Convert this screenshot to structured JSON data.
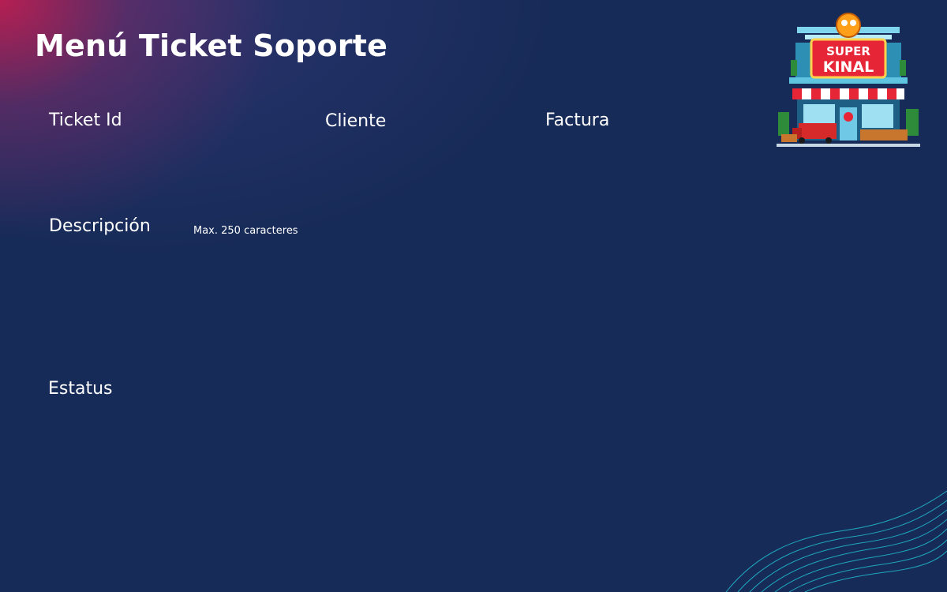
{
  "page": {
    "title": "Menú Ticket Soporte",
    "fields": {
      "ticket_id_label": "Ticket Id",
      "cliente_label": "Cliente",
      "factura_label": "Factura",
      "descripcion_label": "Descripción",
      "descripcion_hint": "Max. 250 caracteres",
      "estatus_label": "Estatus"
    }
  },
  "logo": {
    "text_line1": "SUPER",
    "text_line2": "KINAL",
    "icon": "storefront-icon"
  },
  "colors": {
    "background": "#172b58",
    "accent_magenta": "#be1e50",
    "wave": "#1fb5c7",
    "text": "#ffffff"
  }
}
